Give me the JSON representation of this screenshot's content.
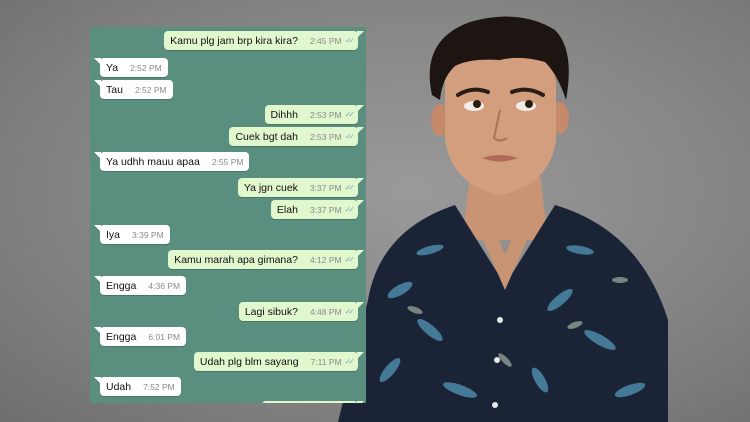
{
  "messages": [
    {
      "dir": "out",
      "text": "Kamu plg jam brp kira kira?",
      "time": "2:45 PM"
    },
    {
      "dir": "in",
      "text": "Ya",
      "time": "2:52 PM"
    },
    {
      "dir": "in",
      "text": "Tau",
      "time": "2:52 PM"
    },
    {
      "dir": "out",
      "text": "Dihhh",
      "time": "2:53 PM"
    },
    {
      "dir": "out",
      "text": "Cuek bgt dah",
      "time": "2:53 PM"
    },
    {
      "dir": "in",
      "text": "Ya udhh mauu apaa",
      "time": "2:55 PM"
    },
    {
      "dir": "out",
      "text": "Ya jgn cuek",
      "time": "3:37 PM"
    },
    {
      "dir": "out",
      "text": "Elah",
      "time": "3:37 PM"
    },
    {
      "dir": "in",
      "text": "Iya",
      "time": "3:39 PM"
    },
    {
      "dir": "out",
      "text": "Kamu marah apa gimana?",
      "time": "4:12 PM"
    },
    {
      "dir": "in",
      "text": "Engga",
      "time": "4:36 PM"
    },
    {
      "dir": "out",
      "text": "Lagi sibuk?",
      "time": "4:48 PM"
    },
    {
      "dir": "in",
      "text": "Engga",
      "time": "6:01 PM"
    },
    {
      "dir": "out",
      "text": "Udah plg blm sayang",
      "time": "7:11 PM"
    },
    {
      "dir": "in",
      "text": "Udah",
      "time": "7:52 PM"
    }
  ],
  "read_icon": "double-check-icon",
  "colors": {
    "chat_bg": "#5a8f7f",
    "outgoing": "#e1f7cd",
    "incoming": "#ffffff",
    "shirt": "#1b2436"
  }
}
